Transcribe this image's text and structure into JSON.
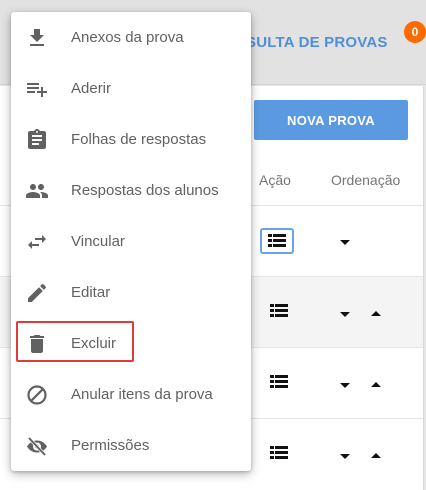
{
  "header": {
    "title": "SULTA DE PROVAS",
    "notification_count": "0"
  },
  "toolbar": {
    "new_button_label": "NOVA PROVA"
  },
  "table": {
    "columns": {
      "action": "Ação",
      "order": "Ordenação"
    }
  },
  "menu": {
    "items": [
      {
        "label": "Anexos da prova",
        "icon": "download-icon"
      },
      {
        "label": "Aderir",
        "icon": "playlist-add-icon"
      },
      {
        "label": "Folhas de respostas",
        "icon": "clipboard-list-icon"
      },
      {
        "label": "Respostas dos alunos",
        "icon": "people-icon"
      },
      {
        "label": "Vincular",
        "icon": "swap-arrows-icon"
      },
      {
        "label": "Editar",
        "icon": "pencil-icon"
      },
      {
        "label": "Excluir",
        "icon": "trash-icon",
        "highlighted": true
      },
      {
        "label": "Anular itens da prova",
        "icon": "block-icon"
      },
      {
        "label": "Permissões",
        "icon": "eye-off-icon"
      }
    ]
  },
  "colors": {
    "accent": "#5b9ae0",
    "badge": "#ff6a00",
    "highlight": "#e03a3a",
    "menu_icon": "#616161"
  }
}
